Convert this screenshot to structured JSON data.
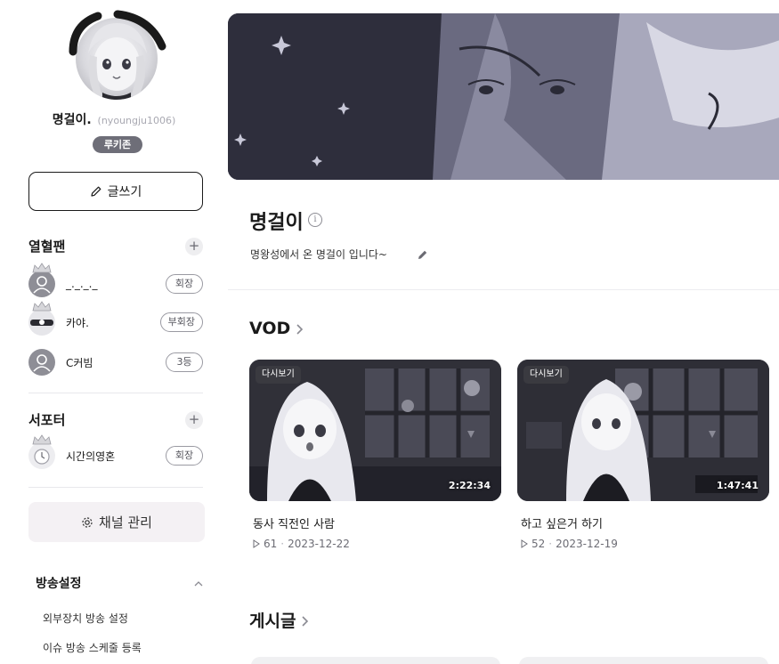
{
  "profile": {
    "name": "명걸이.",
    "handle": "(nyoungju1006)",
    "badge": "루키존",
    "write_label": "글쓰기"
  },
  "fans": {
    "title": "열혈팬",
    "items": [
      {
        "name": "_._._._",
        "role": "회장",
        "avatar_icon": "default-user-icon"
      },
      {
        "name": "카야.",
        "role": "부회장",
        "avatar_icon": "character-avatar"
      },
      {
        "name": "C커빔",
        "role": "3등",
        "avatar_icon": "default-user-icon"
      }
    ]
  },
  "supporters": {
    "title": "서포터",
    "items": [
      {
        "name": "시간의영혼",
        "role": "회장",
        "avatar_icon": "clock-avatar"
      }
    ]
  },
  "channel_manage_label": "채널 관리",
  "broadcast_settings": {
    "title": "방송설정",
    "links": [
      "외부장치 방송 설정",
      "이슈 방송 스케줄 등록"
    ]
  },
  "channel": {
    "title": "명걸이",
    "description": "명왕성에서 온 명걸이 입니다~"
  },
  "vod": {
    "title": "VOD",
    "items": [
      {
        "badge": "다시보기",
        "duration": "2:22:34",
        "title": "동사 직전인 사람",
        "views": "61",
        "date": "2023-12-22"
      },
      {
        "badge": "다시보기",
        "duration": "1:47:41",
        "title": "하고 싶은거 하기",
        "views": "52",
        "date": "2023-12-19"
      }
    ]
  },
  "posts": {
    "title": "게시글"
  },
  "colors": {
    "accent_dark": "#1a1a1a",
    "badge_bg": "#6e6e78",
    "channel_btn_bg": "#f4f1f4",
    "muted_text": "#6c6c74"
  }
}
